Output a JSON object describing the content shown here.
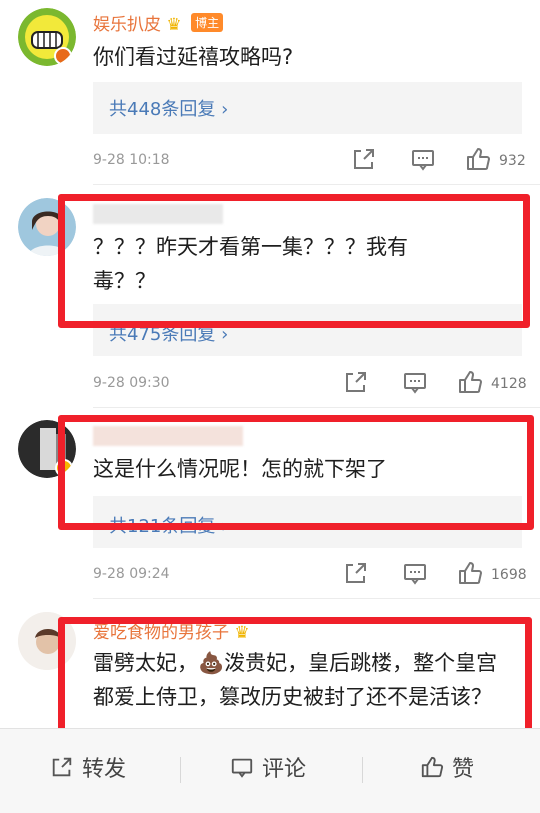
{
  "comments": [
    {
      "username": "娱乐扒皮",
      "badge": "博主",
      "text": "你们看过延禧攻略吗?",
      "replies": "共448条回复 ›",
      "time": "9-28 10:18",
      "likes": "932"
    },
    {
      "text": "？？？昨天才看第一集？？？我有毒？？",
      "replies": "共475条回复 ›",
      "time": "9-28 09:30",
      "likes": "4128"
    },
    {
      "text": "这是什么情况呢！怎的就下架了",
      "replies": "共121条回复 ›",
      "time": "9-28 09:24",
      "likes": "1698"
    },
    {
      "username": "爱吃食物的男孩子",
      "text": "雷劈太妃，💩泼贵妃，皇后跳楼，整个皇宫都爱上侍卫，篡改历史被封了还不是活该？"
    }
  ],
  "bottom_bar": {
    "repost": "转发",
    "comment": "评论",
    "like": "赞"
  },
  "colors": {
    "highlight": "#f0202a",
    "link": "#4a7ab7",
    "username": "#e8743b"
  }
}
